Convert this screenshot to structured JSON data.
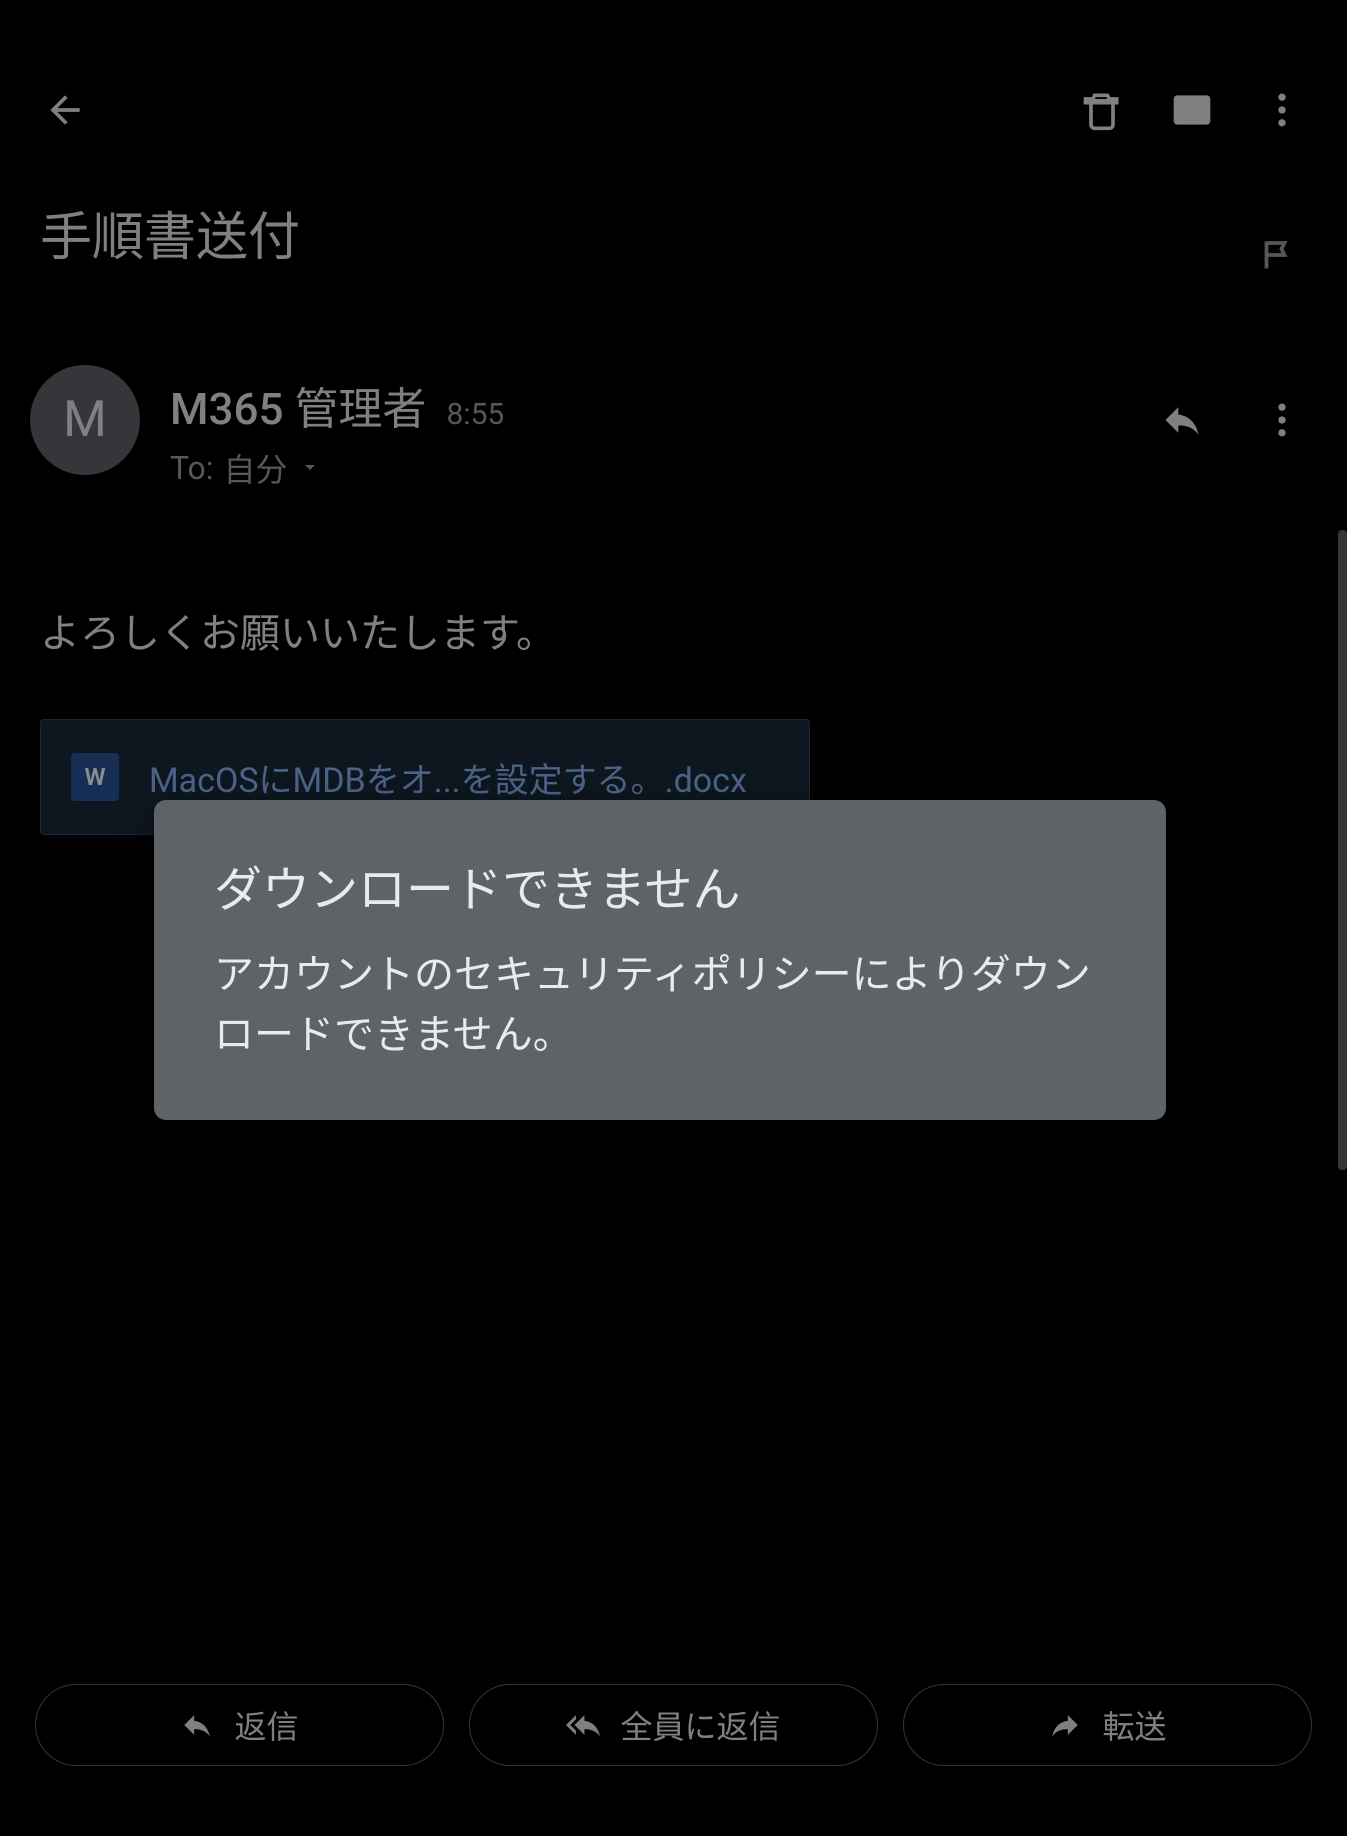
{
  "topbar": {
    "back_name": "back-button",
    "delete_name": "delete-button",
    "mark_unread_name": "mark-unread-button",
    "more_name": "more-button"
  },
  "subject": {
    "title": "手順書送付",
    "flag_name": "flag-button"
  },
  "sender": {
    "avatar_letter": "M",
    "name": "M365 管理者",
    "time": "8:55",
    "to_label": "To:",
    "recipient": "自分"
  },
  "body": {
    "text": "よろしくお願いいたします。"
  },
  "attachment": {
    "icon_letter": "W",
    "filename": "MacOSにMDBをオ...を設定する。.docx"
  },
  "toast": {
    "title": "ダウンロードできません",
    "body": "アカウントのセキュリティポリシーによりダウンロードできません。"
  },
  "actions": {
    "reply": "返信",
    "reply_all": "全員に返信",
    "forward": "転送"
  }
}
